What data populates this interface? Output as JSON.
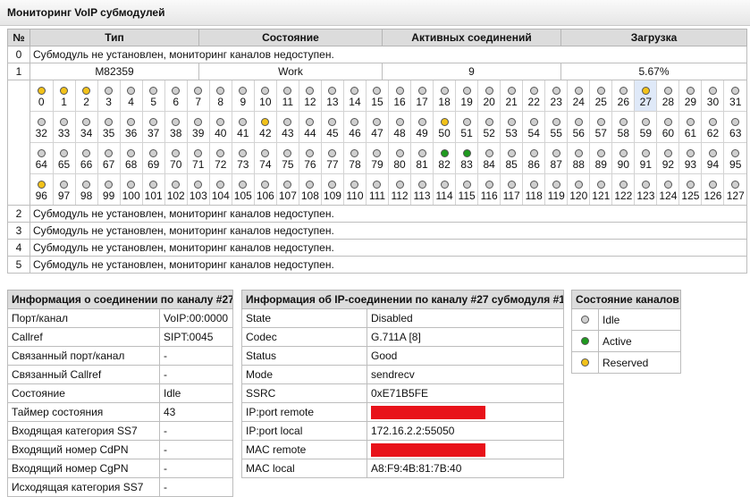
{
  "page": {
    "title": "Мониторинг VoIP субмодулей"
  },
  "monitor": {
    "headers": {
      "num": "№",
      "type": "Тип",
      "state": "Состояние",
      "active": "Активных соединений",
      "load": "Загрузка"
    },
    "not_installed_message": "Субмодуль не установлен, мониторинг каналов недоступен.",
    "rows": [
      {
        "num": "0",
        "message": "Субмодуль не установлен, мониторинг каналов недоступен."
      },
      {
        "num": "1",
        "type": "M82359",
        "state": "Work",
        "active": "9",
        "load": "5.67%"
      },
      {
        "num": "2",
        "message": "Субмодуль не установлен, мониторинг каналов недоступен."
      },
      {
        "num": "3",
        "message": "Субмодуль не установлен, мониторинг каналов недоступен."
      },
      {
        "num": "4",
        "message": "Субмодуль не установлен, мониторинг каналов недоступен."
      },
      {
        "num": "5",
        "message": "Субмодуль не установлен, мониторинг каналов недоступен."
      }
    ],
    "channels": {
      "count": 128,
      "per_row": 32,
      "reserved": [
        0,
        1,
        2,
        27,
        42,
        50,
        96
      ],
      "active": [
        82,
        83
      ],
      "selected": 27
    }
  },
  "connection_info": {
    "title": "Информация о соединении по каналу #27",
    "rows": [
      {
        "label": "Порт/канал",
        "value": "VoIP:00:0000"
      },
      {
        "label": "Callref",
        "value": "SIPT:0045"
      },
      {
        "label": "Связанный порт/канал",
        "value": "-"
      },
      {
        "label": "Связанный Callref",
        "value": "-"
      },
      {
        "label": "Состояние",
        "value": "Idle"
      },
      {
        "label": "Таймер состояния",
        "value": "43"
      },
      {
        "label": "Входящая категория SS7",
        "value": "-"
      },
      {
        "label": "Входящий номер CdPN",
        "value": "-"
      },
      {
        "label": "Входящий номер CgPN",
        "value": "-"
      },
      {
        "label": "Исходящая категория SS7",
        "value": "-"
      }
    ]
  },
  "ip_info": {
    "title": "Информация об IP-соединении по каналу #27 субмодуля #1",
    "rows": [
      {
        "label": "State",
        "value": "Disabled"
      },
      {
        "label": "Codec",
        "value": "G.711A [8]"
      },
      {
        "label": "Status",
        "value": "Good"
      },
      {
        "label": "Mode",
        "value": "sendrecv"
      },
      {
        "label": "SSRC",
        "value": "0xE71B5FE"
      },
      {
        "label": "IP:port remote",
        "value": "",
        "redacted": true
      },
      {
        "label": "IP:port local",
        "value": "172.16.2.2:55050"
      },
      {
        "label": "MAC remote",
        "value": "",
        "redacted": true
      },
      {
        "label": "MAC local",
        "value": "A8:F9:4B:81:7B:40"
      }
    ]
  },
  "legend": {
    "title": "Состояние каналов",
    "items": [
      {
        "label": "Idle",
        "color": "#cfcfcf",
        "icon": "idle-status-icon"
      },
      {
        "label": "Active",
        "color": "#1f9a1f",
        "icon": "active-status-icon"
      },
      {
        "label": "Reserved",
        "color": "#f2c21a",
        "icon": "reserved-status-icon"
      }
    ]
  },
  "colors": {
    "idle": "#cfcfcf",
    "active": "#1f9a1f",
    "reserved": "#f2c21a",
    "redaction": "#e8121a",
    "highlight": "#dfe9f8"
  }
}
